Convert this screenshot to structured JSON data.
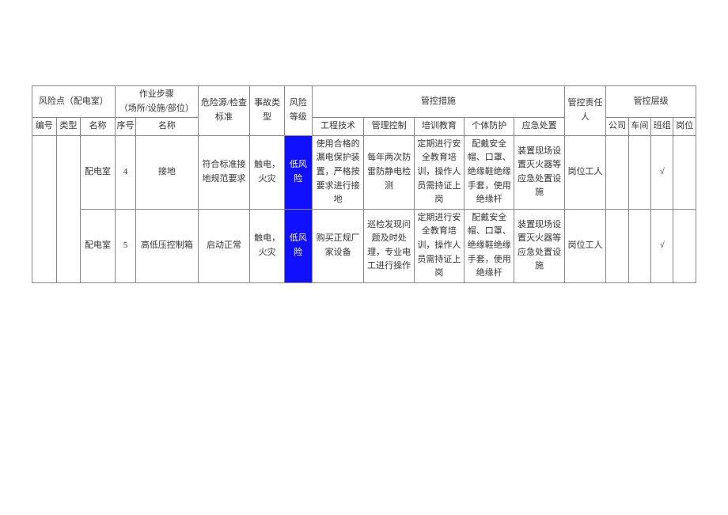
{
  "headers": {
    "risk_point": "风险点（配电室）",
    "work_steps": "作业步骤\n（场所/设施/部位）",
    "hazard_std": "危险源/检查标准",
    "accident_type": "事故类型",
    "risk_level": "风险等级",
    "control_measures": "管控措施",
    "responsible": "管控责任人",
    "control_levels": "管控层级",
    "row2": {
      "no": "编号",
      "type": "类型",
      "name": "名称",
      "seq": "序号",
      "step_name": "名称",
      "engineering": "工程技术",
      "management": "管理控制",
      "training": "培训教育",
      "ppe": "个体防护",
      "emergency": "应急处置",
      "company": "公司",
      "workshop": "车间",
      "team": "班组",
      "post": "岗位"
    }
  },
  "rows": [
    {
      "no": "",
      "type": "",
      "name": "配电室",
      "seq": "4",
      "step_name": "接地",
      "hazard_std": "符合标准接地规范要求",
      "accident_type": "触电，火灾",
      "risk_level": "低风险",
      "engineering": "使用合格的漏电保护装置，严格按要求进行接地",
      "management": "每年两次防雷防静电检测",
      "training": "定期进行安全教育培训，操作人员需持证上岗",
      "ppe": "配戴安全帽、口罩、绝缘鞋绝缘手套，使用绝缘杆",
      "emergency": "装置现场设置灭火器等应急处置设施",
      "responsible": "岗位工人",
      "company": "",
      "workshop": "",
      "team": "√",
      "post": ""
    },
    {
      "no": "",
      "type": "",
      "name": "配电室",
      "seq": "5",
      "step_name": "高低压控制箱",
      "hazard_std": "启动正常",
      "accident_type": "触电，火灾",
      "risk_level": "低风险",
      "engineering": "购买正规厂家设备",
      "management": "巡检发现问题及时处理，专业电工进行操作",
      "training": "定期进行安全教育培训，操作人员需持证上岗",
      "ppe": "配戴安全帽、口罩、绝缘鞋绝缘手套，使用绝缘杆",
      "emergency": "装置现场设置灭火器等应急处置设施",
      "responsible": "岗位工人",
      "company": "",
      "workshop": "",
      "team": "√",
      "post": ""
    }
  ]
}
